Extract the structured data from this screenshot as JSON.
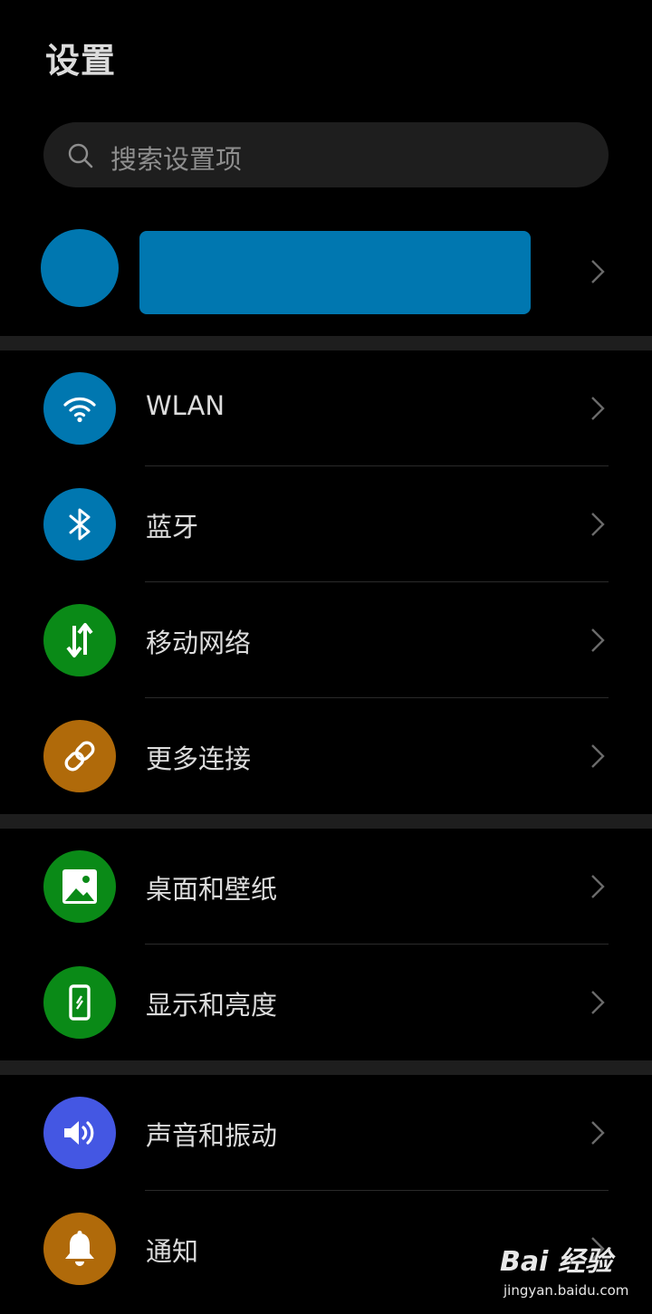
{
  "header": {
    "title": "设置"
  },
  "search": {
    "placeholder": "搜索设置项",
    "icon": "search-icon"
  },
  "account": {
    "avatar_color": "#0077b0",
    "name_redacted_color": "#0077b0"
  },
  "groups": [
    {
      "items": [
        {
          "label": "WLAN",
          "icon": "wifi-icon",
          "color": "#0077b0"
        },
        {
          "label": "蓝牙",
          "icon": "bluetooth-icon",
          "color": "#0077b0"
        },
        {
          "label": "移动网络",
          "icon": "mobile-data-icon",
          "color": "#0a8a17"
        },
        {
          "label": "更多连接",
          "icon": "link-icon",
          "color": "#b06a0a"
        }
      ]
    },
    {
      "items": [
        {
          "label": "桌面和壁纸",
          "icon": "wallpaper-icon",
          "color": "#0a8a17"
        },
        {
          "label": "显示和亮度",
          "icon": "display-icon",
          "color": "#0a8a17"
        }
      ]
    },
    {
      "items": [
        {
          "label": "声音和振动",
          "icon": "sound-icon",
          "color": "#4457e3"
        },
        {
          "label": "通知",
          "icon": "bell-icon",
          "color": "#b06a0a"
        }
      ]
    }
  ],
  "watermark": {
    "main": "Bai 经验",
    "sub": "jingyan.baidu.com"
  }
}
